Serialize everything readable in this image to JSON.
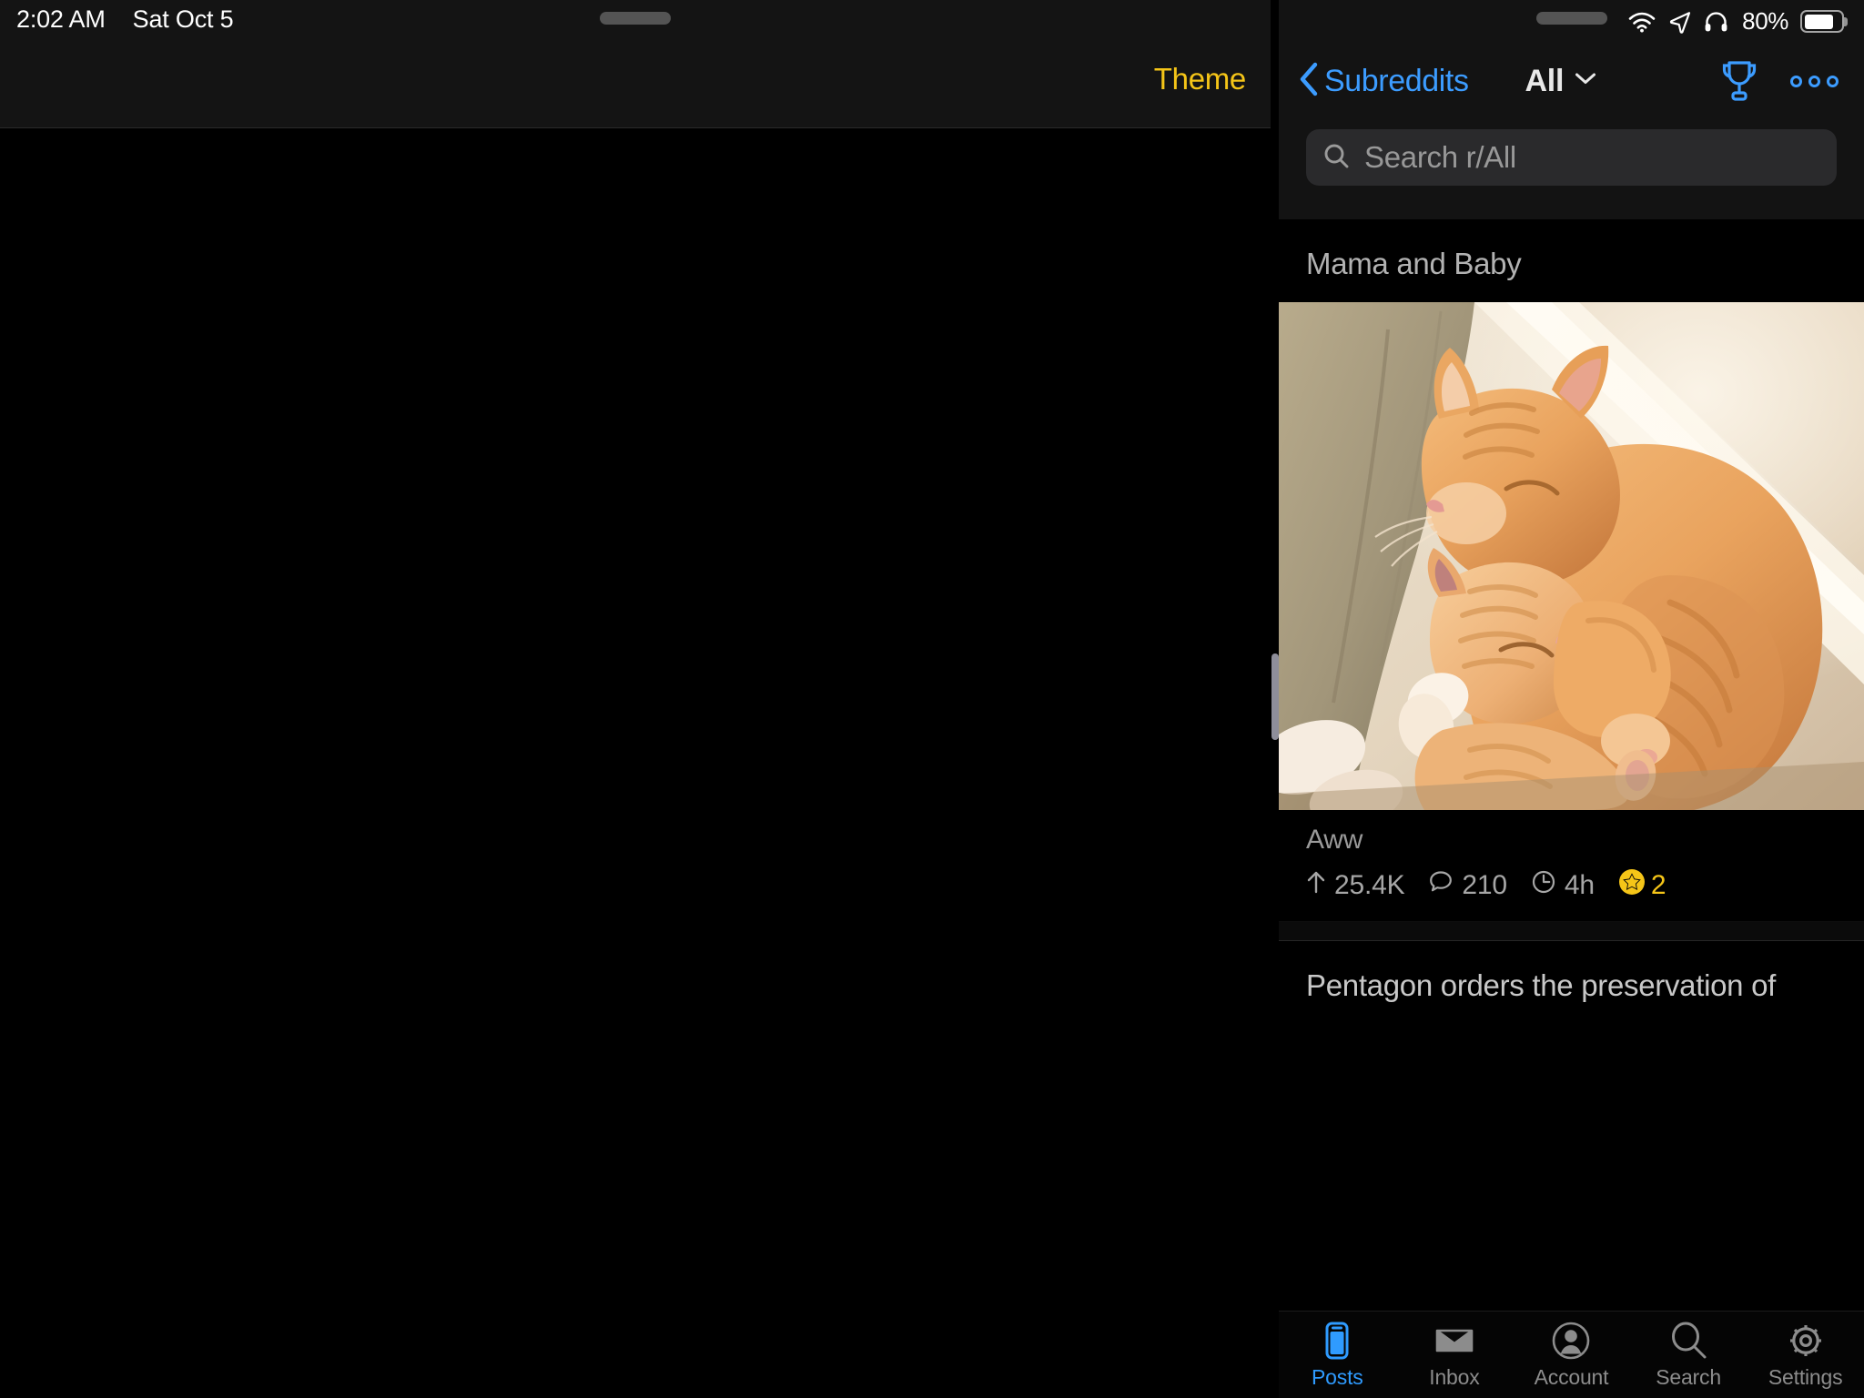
{
  "status_bar": {
    "time": "2:02 AM",
    "date": "Sat Oct 5",
    "battery_percent": "80%",
    "icons": [
      "wifi-icon",
      "location-arrow-icon",
      "headphones-icon",
      "battery-icon"
    ]
  },
  "left_pane": {
    "theme_button": "Theme",
    "drag_handle": "drag-handle",
    "body": ""
  },
  "right_pane": {
    "nav": {
      "back_label": "Subreddits",
      "back_icon": "chevron-left-icon",
      "sort_label": "All",
      "sort_icon": "chevron-down-icon",
      "trophy_icon": "trophy-icon",
      "more_icon": "more-horizontal-icon"
    },
    "search": {
      "placeholder": "Search r/All",
      "value": "",
      "icon": "search-icon"
    },
    "feed": [
      {
        "title": "Mama and Baby",
        "has_image": true,
        "image_alt": "two orange tabby cats cuddling",
        "subreddit": "Aww",
        "upvotes": "25.4K",
        "comments": "210",
        "age": "4h",
        "awards": "2"
      },
      {
        "title": "Pentagon orders the preservation of",
        "has_image": false
      }
    ],
    "tabs": [
      {
        "label": "Posts",
        "icon": "phone-icon",
        "active": true
      },
      {
        "label": "Inbox",
        "icon": "envelope-icon",
        "active": false
      },
      {
        "label": "Account",
        "icon": "person-icon",
        "active": false
      },
      {
        "label": "Search",
        "icon": "search-icon",
        "active": false
      },
      {
        "label": "Settings",
        "icon": "gear-icon",
        "active": false
      }
    ]
  },
  "colors": {
    "accent_blue": "#3c9cff",
    "accent_yellow": "#f5c518",
    "tab_active": "#2f9bff",
    "background": "#000000",
    "header_background": "#141414",
    "search_background": "#2a2a2c"
  }
}
